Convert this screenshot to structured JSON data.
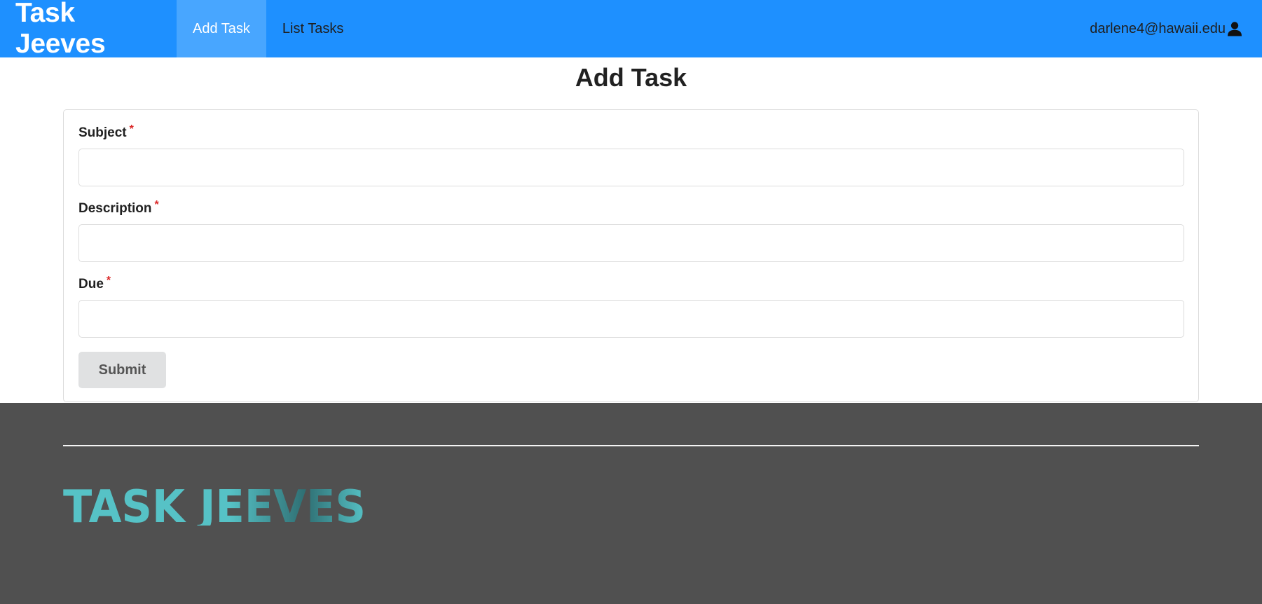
{
  "navbar": {
    "brand": "Task Jeeves",
    "items": [
      {
        "label": "Add Task",
        "active": true
      },
      {
        "label": "List Tasks",
        "active": false
      }
    ],
    "user_email": "darlene4@hawaii.edu",
    "user_icon": "user-icon",
    "background_color": "#1e90ff",
    "active_color": "#48a6ff"
  },
  "main": {
    "title": "Add Task",
    "form": {
      "fields": [
        {
          "label": "Subject",
          "required_mark": "*",
          "value": "",
          "placeholder": ""
        },
        {
          "label": "Description",
          "required_mark": "*",
          "value": "",
          "placeholder": ""
        },
        {
          "label": "Due",
          "required_mark": "*",
          "value": "",
          "placeholder": ""
        }
      ],
      "submit_label": "Submit",
      "required_color": "#db2828"
    }
  },
  "footer": {
    "logo_text": "TASK JEEVES",
    "background_color": "#505050",
    "logo_color": "#56c2c6"
  }
}
